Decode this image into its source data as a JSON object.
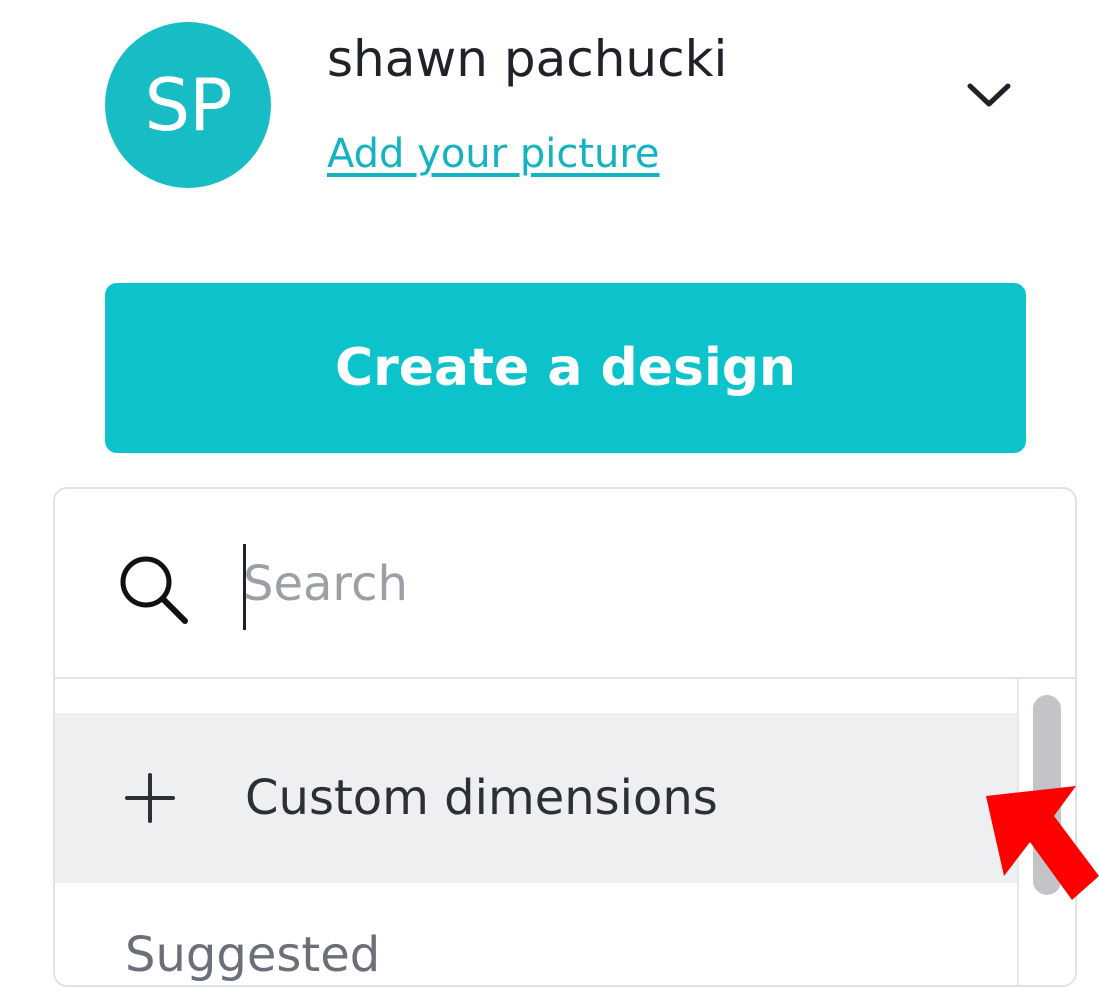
{
  "user": {
    "initials": "SP",
    "name": "shawn pachucki",
    "add_picture_label": "Add your picture"
  },
  "actions": {
    "create_design_label": "Create a design"
  },
  "search": {
    "placeholder": "Search",
    "value": ""
  },
  "dropdown": {
    "custom_dimensions_label": "Custom dimensions",
    "section_heading": "Suggested"
  },
  "icons": {
    "chevron": "chevron-down-icon",
    "search": "search-icon",
    "plus": "plus-icon",
    "annotation_arrow": "red-arrow-icon"
  },
  "colors": {
    "brand": "#0cc3cc",
    "avatar": "#17bcc4",
    "link": "#13b3bf",
    "annotation": "#ff0000"
  }
}
